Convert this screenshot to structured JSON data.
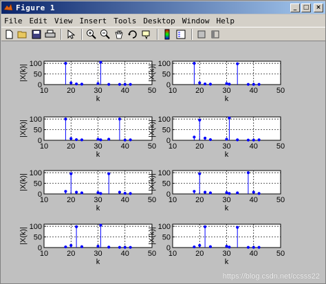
{
  "window": {
    "title": "Figure 1",
    "controls": [
      "_",
      "□",
      "×"
    ]
  },
  "menu": [
    "File",
    "Edit",
    "View",
    "Insert",
    "Tools",
    "Desktop",
    "Window",
    "Help"
  ],
  "toolbar": {
    "icons": [
      "new-icon",
      "open-icon",
      "save-icon",
      "print-icon",
      "pointer-icon",
      "zoom-in-icon",
      "zoom-out-icon",
      "pan-icon",
      "rotate-icon",
      "datacursor-icon",
      "colorbar-icon",
      "legend-icon",
      "hide-plot-tools-icon",
      "show-plot-tools-icon"
    ]
  },
  "watermark": "https://blog.csdn.net/ccsss22",
  "colors": {
    "stem": "#0000ff",
    "background": "#c0c0c0",
    "axes_bg": "#ffffff",
    "grid": "#000000"
  },
  "chart_data": [
    {
      "type": "scatter",
      "xlabel": "k",
      "ylabel": "|X(k)|",
      "xlim": [
        10,
        50
      ],
      "ylim": [
        0,
        110
      ],
      "xticks": [
        10,
        20,
        30,
        40,
        50
      ],
      "yticks": [
        0,
        50,
        100
      ],
      "grid": true,
      "x": [
        18,
        20,
        22,
        24,
        30,
        31,
        34,
        38,
        40,
        42
      ],
      "y": [
        100,
        8,
        3,
        2,
        5,
        105,
        1,
        1,
        1,
        1
      ]
    },
    {
      "type": "scatter",
      "xlabel": "k",
      "ylabel": "|X(k)|",
      "xlim": [
        10,
        50
      ],
      "ylim": [
        0,
        110
      ],
      "xticks": [
        10,
        20,
        30,
        40,
        50
      ],
      "yticks": [
        0,
        50,
        100
      ],
      "grid": true,
      "x": [
        18,
        20,
        22,
        24,
        30,
        31,
        34,
        38,
        40,
        42
      ],
      "y": [
        100,
        8,
        3,
        2,
        5,
        2,
        98,
        1,
        1,
        1
      ]
    },
    {
      "type": "scatter",
      "xlabel": "k",
      "ylabel": "|X(k)|",
      "xlim": [
        10,
        50
      ],
      "ylim": [
        0,
        110
      ],
      "xticks": [
        10,
        20,
        30,
        40,
        50
      ],
      "yticks": [
        0,
        50,
        100
      ],
      "grid": true,
      "x": [
        18,
        20,
        22,
        24,
        30,
        31,
        34,
        38,
        40,
        42
      ],
      "y": [
        100,
        8,
        3,
        2,
        5,
        2,
        5,
        100,
        1,
        2
      ]
    },
    {
      "type": "scatter",
      "xlabel": "k",
      "ylabel": "|X(k)|",
      "xlim": [
        10,
        50
      ],
      "ylim": [
        0,
        110
      ],
      "xticks": [
        10,
        20,
        30,
        40,
        50
      ],
      "yticks": [
        0,
        50,
        100
      ],
      "grid": true,
      "x": [
        18,
        20,
        22,
        24,
        30,
        31,
        34,
        38,
        40,
        42
      ],
      "y": [
        15,
        95,
        10,
        3,
        5,
        105,
        2,
        1,
        1,
        2
      ]
    },
    {
      "type": "scatter",
      "xlabel": "k",
      "ylabel": "|X(k)|",
      "xlim": [
        10,
        50
      ],
      "ylim": [
        0,
        110
      ],
      "xticks": [
        10,
        20,
        30,
        40,
        50
      ],
      "yticks": [
        0,
        50,
        100
      ],
      "grid": true,
      "x": [
        18,
        20,
        22,
        24,
        30,
        31,
        34,
        38,
        40,
        42
      ],
      "y": [
        12,
        95,
        8,
        5,
        6,
        2,
        95,
        8,
        3,
        2
      ]
    },
    {
      "type": "scatter",
      "xlabel": "k",
      "ylabel": "|X(k)|",
      "xlim": [
        10,
        50
      ],
      "ylim": [
        0,
        110
      ],
      "xticks": [
        10,
        20,
        30,
        40,
        50
      ],
      "yticks": [
        0,
        50,
        100
      ],
      "grid": true,
      "x": [
        18,
        20,
        22,
        24,
        30,
        31,
        34,
        38,
        40,
        42
      ],
      "y": [
        12,
        95,
        8,
        5,
        6,
        2,
        5,
        100,
        8,
        2
      ]
    },
    {
      "type": "scatter",
      "xlabel": "k",
      "ylabel": "|X(k)|",
      "xlim": [
        10,
        50
      ],
      "ylim": [
        0,
        110
      ],
      "xticks": [
        10,
        20,
        30,
        40,
        50
      ],
      "yticks": [
        0,
        50,
        100
      ],
      "grid": true,
      "x": [
        18,
        20,
        22,
        24,
        30,
        31,
        34,
        38,
        40,
        42
      ],
      "y": [
        3,
        10,
        98,
        4,
        6,
        105,
        2,
        1,
        1,
        1
      ]
    },
    {
      "type": "scatter",
      "xlabel": "k",
      "ylabel": "|X(k)|",
      "xlim": [
        10,
        50
      ],
      "ylim": [
        0,
        110
      ],
      "xticks": [
        10,
        20,
        30,
        40,
        50
      ],
      "yticks": [
        0,
        50,
        100
      ],
      "grid": true,
      "x": [
        18,
        20,
        22,
        24,
        30,
        31,
        34,
        38,
        40,
        42
      ],
      "y": [
        3,
        10,
        98,
        4,
        6,
        2,
        95,
        1,
        1,
        1
      ]
    }
  ]
}
